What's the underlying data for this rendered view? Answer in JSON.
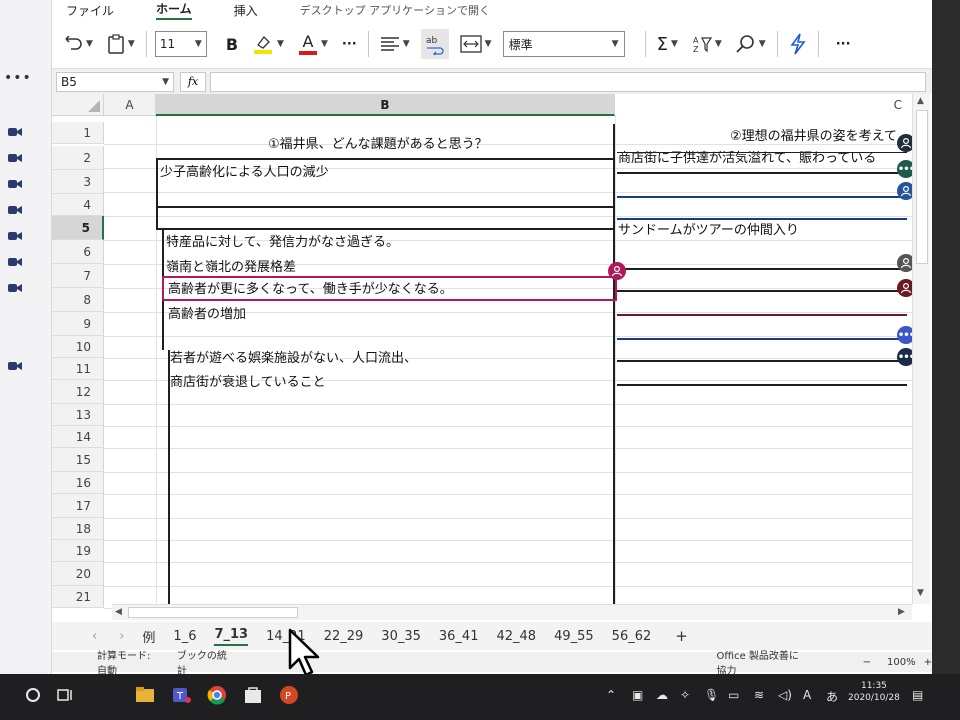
{
  "ribbon": {
    "tabs": [
      {
        "label": "ファイル"
      },
      {
        "label": "ホーム"
      },
      {
        "label": "挿入"
      },
      {
        "label": "デスクトップ アプリケーションで開く"
      }
    ]
  },
  "toolbar": {
    "font_size": "11",
    "bold_label": "B",
    "font_color_label": "A",
    "more_label": "···",
    "number_format": "標準",
    "overflow_label": "···"
  },
  "formula_bar": {
    "name_box": "B5",
    "fx_label": "fx"
  },
  "grid": {
    "columns": [
      {
        "label": ""
      },
      {
        "label": "A"
      },
      {
        "label": "B"
      },
      {
        "label": "C"
      }
    ],
    "rows": [
      "1",
      "2",
      "3",
      "4",
      "5",
      "6",
      "7",
      "8",
      "9",
      "10",
      "11",
      "12",
      "13",
      "14",
      "15",
      "16",
      "17",
      "18",
      "19",
      "20",
      "21"
    ],
    "selected_row": "5",
    "cells": {
      "b2": "①福井県、どんな課題があると思う？",
      "c1": "②理想の福井県の姿を考えて",
      "b3": "少子高齢化による人口の減少",
      "c2": "商店街に子供達が活気溢れて、賑わっている",
      "c5": "サンドームがツアーの仲間入り",
      "b6": "特産品に対して、発信力がなさ過ぎる。",
      "b7": "嶺南と嶺北の発展格差",
      "b8": "高齢者が更に多くなって、働き手が少なくなる。",
      "b9": "高齢者の増加",
      "b11": "若者が遊べる娯楽施設がない、人口流出、",
      "b12": "商店街が衰退していること"
    },
    "presence_colors": [
      "#1f2d3d",
      "#8a1a55",
      "#24559c",
      "#555555",
      "#6b1a22",
      "#3b56c9",
      "#1d2b4a"
    ]
  },
  "sheet_tabs": {
    "items": [
      "例",
      "1_6",
      "7_13",
      "14_21",
      "22_29",
      "30_35",
      "36_41",
      "42_48",
      "49_55",
      "56_62"
    ],
    "active": "7_13",
    "add_label": "+"
  },
  "status_bar": {
    "calc_mode": "計算モード: 自動",
    "book_stats": "ブックの統計",
    "feedback": "Office 製品改善に協力",
    "zoom_minus": "−",
    "zoom": "100%",
    "zoom_plus": "+"
  },
  "taskbar": {
    "ime": "あ",
    "time": "11:35",
    "date": "2020/10/28"
  },
  "colors": {
    "accent": "#217346",
    "magenta": "#b0195c",
    "navy": "#1c3c7a"
  }
}
